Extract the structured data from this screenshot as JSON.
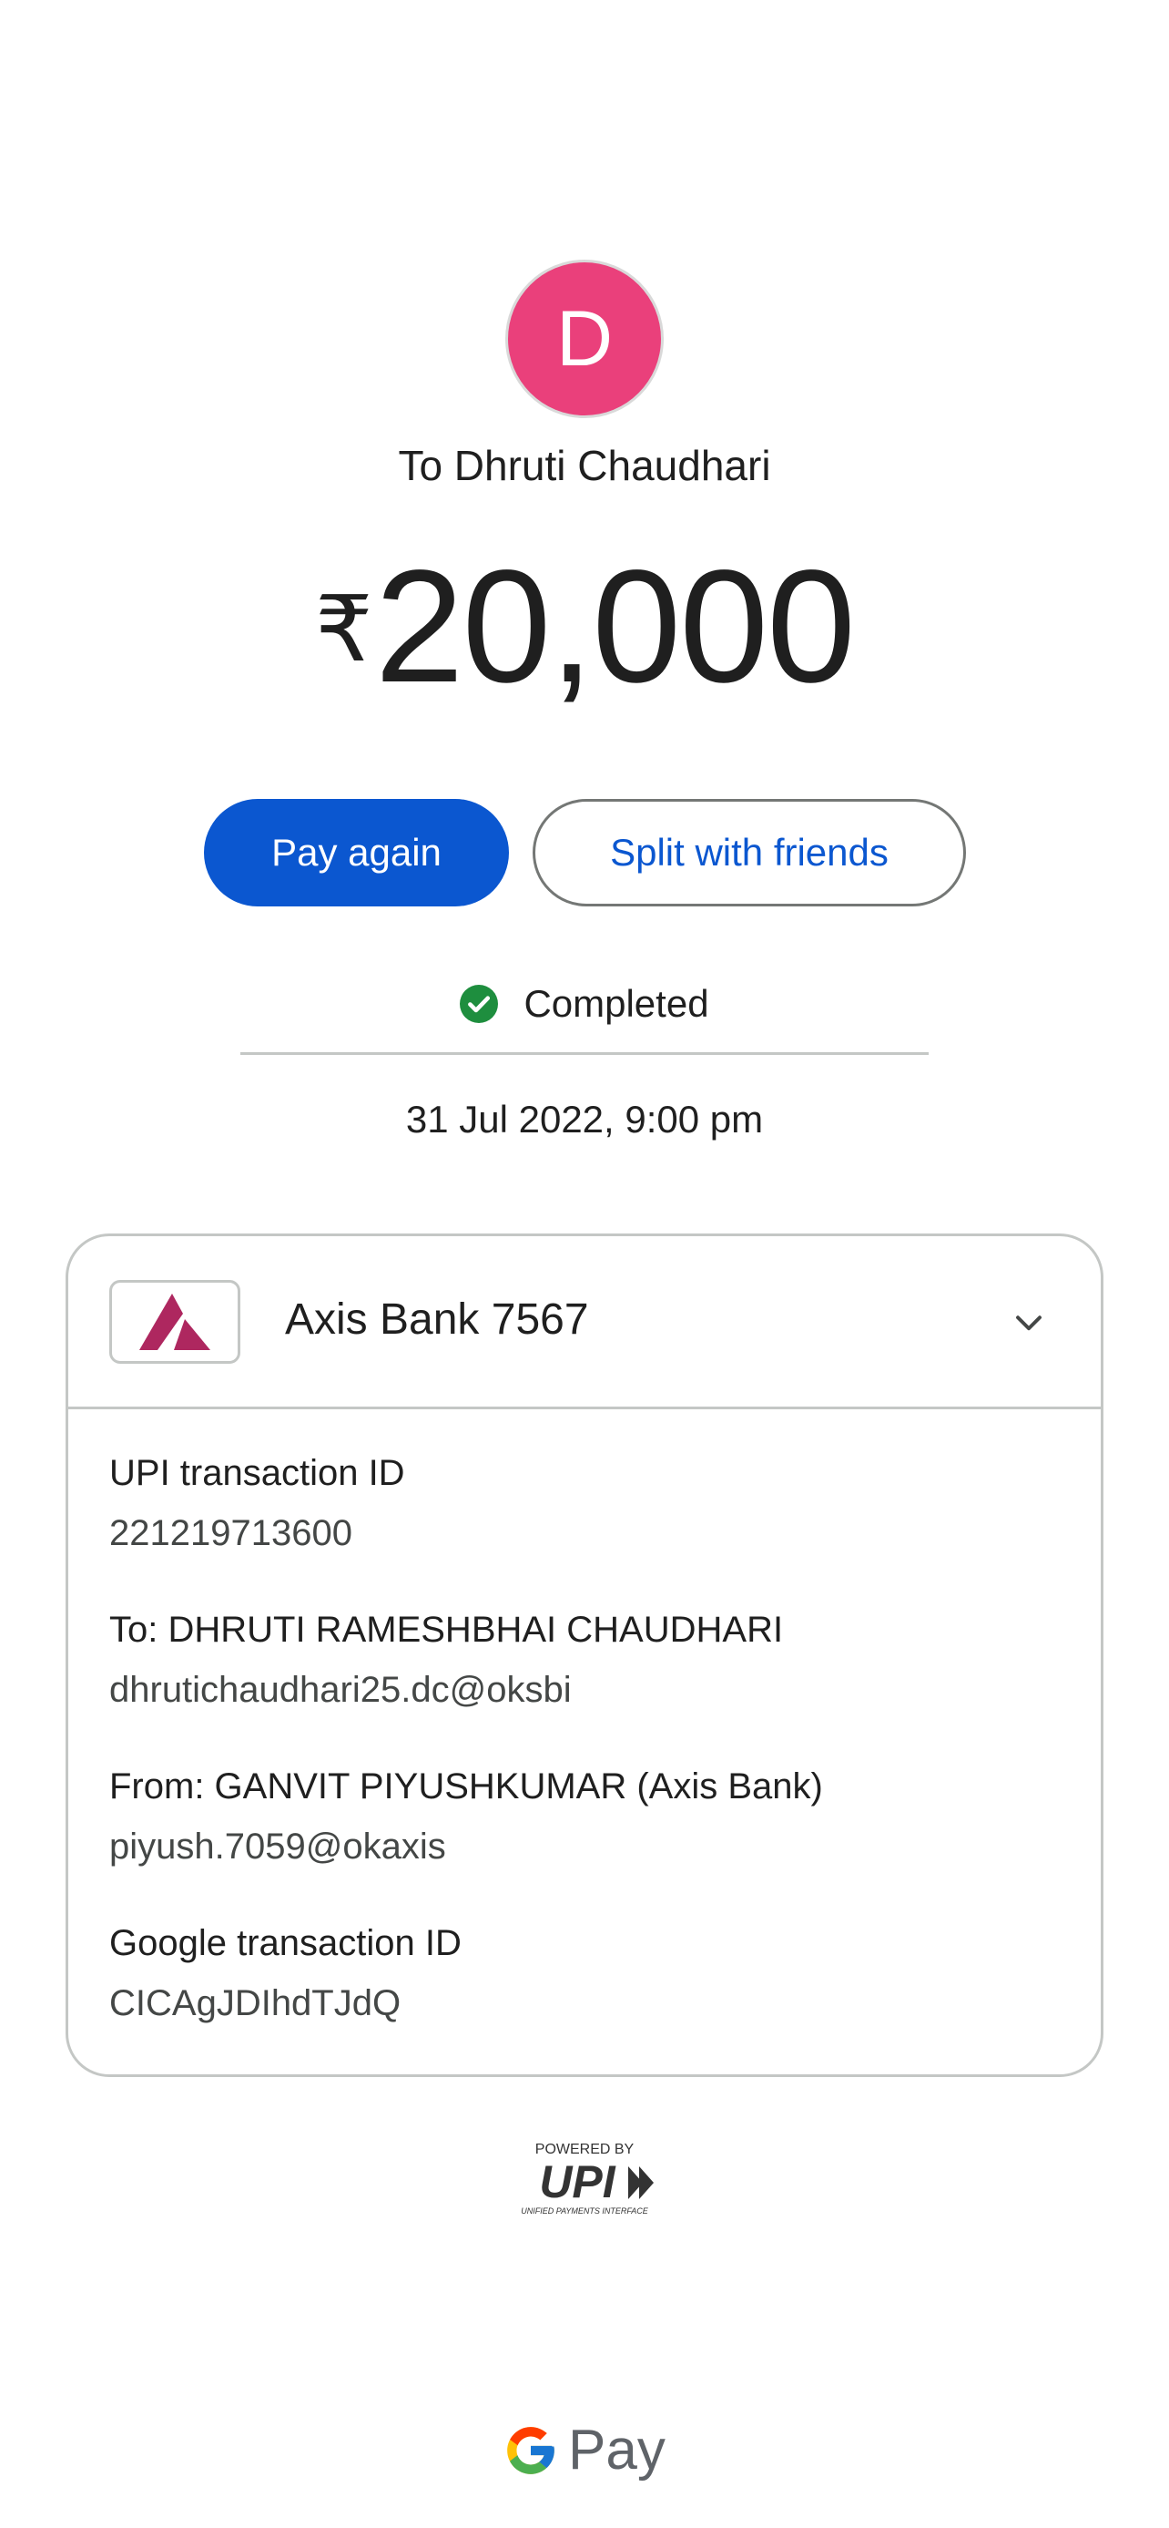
{
  "recipient": {
    "initial": "D",
    "title": "To Dhruti Chaudhari"
  },
  "payment": {
    "currency_symbol": "₹",
    "amount": "20,000"
  },
  "actions": {
    "pay_again_label": "Pay again",
    "split_label": "Split with friends"
  },
  "status": {
    "icon": "check-circle-icon",
    "text": "Completed",
    "datetime": "31 Jul 2022, 9:00 pm"
  },
  "account": {
    "bank_name": "Axis Bank 7567",
    "expand_icon": "chevron-down-icon"
  },
  "details": [
    {
      "label": "UPI transaction ID",
      "value": "221219713600"
    },
    {
      "label": "To: DHRUTI RAMESHBHAI CHAUDHARI",
      "value": "dhrutichaudhari25.dc@oksbi"
    },
    {
      "label": "From: GANVIT PIYUSHKUMAR (Axis Bank)",
      "value": "piyush.7059@okaxis"
    },
    {
      "label": "Google transaction ID",
      "value": "CICAgJDIhdTJdQ"
    }
  ],
  "footer": {
    "upi_powered_by": "POWERED BY",
    "upi_wordmark": "UPI",
    "upi_tagline": "UNIFIED PAYMENTS INTERFACE",
    "app_name": "Pay"
  },
  "colors": {
    "avatar": "#ea407b",
    "primary": "#0b57d0",
    "success": "#1e8e3e",
    "axis_brand": "#ae275f"
  }
}
